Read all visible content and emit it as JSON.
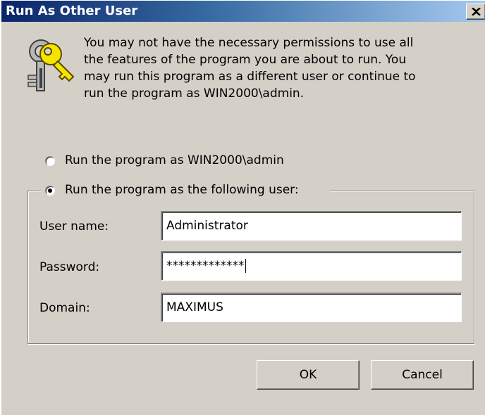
{
  "window": {
    "title": "Run As Other User",
    "close_symbol": "X"
  },
  "icon": "keys-icon",
  "message": "You may not have the necessary permissions to use all\nthe features of the program you are about to run.  You\nmay run this program as a different user or continue to\nrun the program as WIN2000\\admin.",
  "options": {
    "current_user": {
      "label": "Run the program as WIN2000\\admin",
      "selected": false
    },
    "other_user": {
      "label": "Run the program as the following user:",
      "selected": true
    }
  },
  "fields": {
    "user_name": {
      "label": "User name:",
      "value": "Administrator"
    },
    "password": {
      "label": "Password:",
      "value": "*************"
    },
    "domain": {
      "label": "Domain:",
      "value": "MAXIMUS"
    }
  },
  "buttons": {
    "ok": "OK",
    "cancel": "Cancel"
  },
  "colors": {
    "title_gradient_start": "#0a246a",
    "title_gradient_end": "#a6caf0",
    "dialog_background": "#d4d0c8"
  }
}
